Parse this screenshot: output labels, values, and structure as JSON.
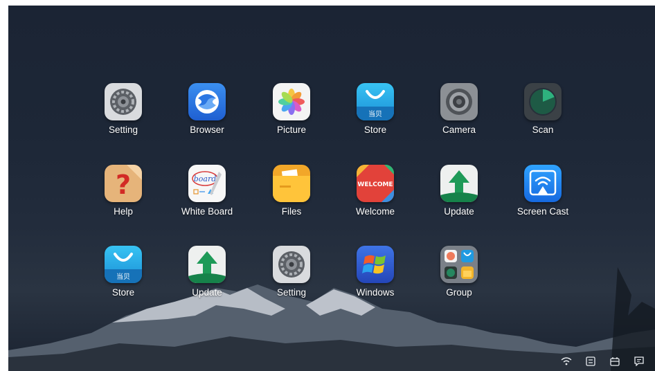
{
  "apps": [
    {
      "label": "Setting",
      "icon": "gear-icon"
    },
    {
      "label": "Browser",
      "icon": "browser-icon"
    },
    {
      "label": "Picture",
      "icon": "pinwheel-icon"
    },
    {
      "label": "Store",
      "icon": "shopping-bag-icon"
    },
    {
      "label": "Camera",
      "icon": "camera-lens-icon"
    },
    {
      "label": "Scan",
      "icon": "radar-icon"
    },
    {
      "label": "Help",
      "icon": "question-mark-icon"
    },
    {
      "label": "White Board",
      "icon": "whiteboard-icon"
    },
    {
      "label": "Files",
      "icon": "folder-icon"
    },
    {
      "label": "Welcome",
      "icon": "welcome-icon"
    },
    {
      "label": "Update",
      "icon": "up-arrow-icon"
    },
    {
      "label": "Screen Cast",
      "icon": "wifi-cast-icon"
    },
    {
      "label": "Store",
      "icon": "shopping-bag-icon"
    },
    {
      "label": "Update",
      "icon": "up-arrow-icon"
    },
    {
      "label": "Setting",
      "icon": "gear-icon"
    },
    {
      "label": "Windows",
      "icon": "windows-logo-icon"
    },
    {
      "label": "Group",
      "icon": "app-group-icon"
    }
  ],
  "icon_text": {
    "store_badge": "当贝",
    "board_word": "board",
    "welcome_word": "WELCOME"
  },
  "tray": [
    "wifi-icon",
    "settings-panel-icon",
    "calendar-icon",
    "message-icon"
  ]
}
